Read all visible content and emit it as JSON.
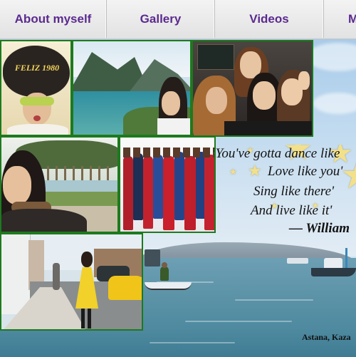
{
  "nav": {
    "tabs": [
      {
        "label": "About myself"
      },
      {
        "label": "Gallery"
      },
      {
        "label": "Videos"
      },
      {
        "label": "M"
      }
    ],
    "text_color": "#5b2a8f"
  },
  "collage": {
    "frame_color": "#1d7a1d",
    "photos": [
      {
        "name": "photo-party-hat",
        "hat_text": "FELIZ 1980"
      },
      {
        "name": "photo-lake-mountains"
      },
      {
        "name": "photo-selfie-cap"
      },
      {
        "name": "photo-group-friends"
      },
      {
        "name": "photo-palm-trees"
      },
      {
        "name": "photo-stage-group"
      },
      {
        "name": "photo-street-yellow-dress"
      }
    ]
  },
  "quote": {
    "lines": [
      "“You've gotta dance like",
      "Love like you'",
      "Sing like there'",
      "And live like it'",
      "— William"
    ]
  },
  "caption": "Astana, Kaza"
}
